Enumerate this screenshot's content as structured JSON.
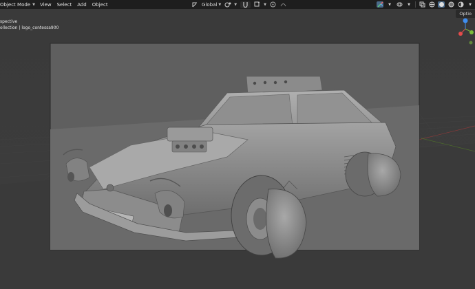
{
  "header": {
    "mode_label": "Object Mode",
    "menus": [
      "View",
      "Select",
      "Add",
      "Object"
    ],
    "transform_orientation": "Global"
  },
  "viewport": {
    "view_title": "spective",
    "collection_path": "ollection | logo_contessa900",
    "options_label": "Optio"
  },
  "gizmo": {
    "x_color": "#e54b4b",
    "y_color": "#7bbd3a",
    "z_color": "#3f8ef0"
  }
}
